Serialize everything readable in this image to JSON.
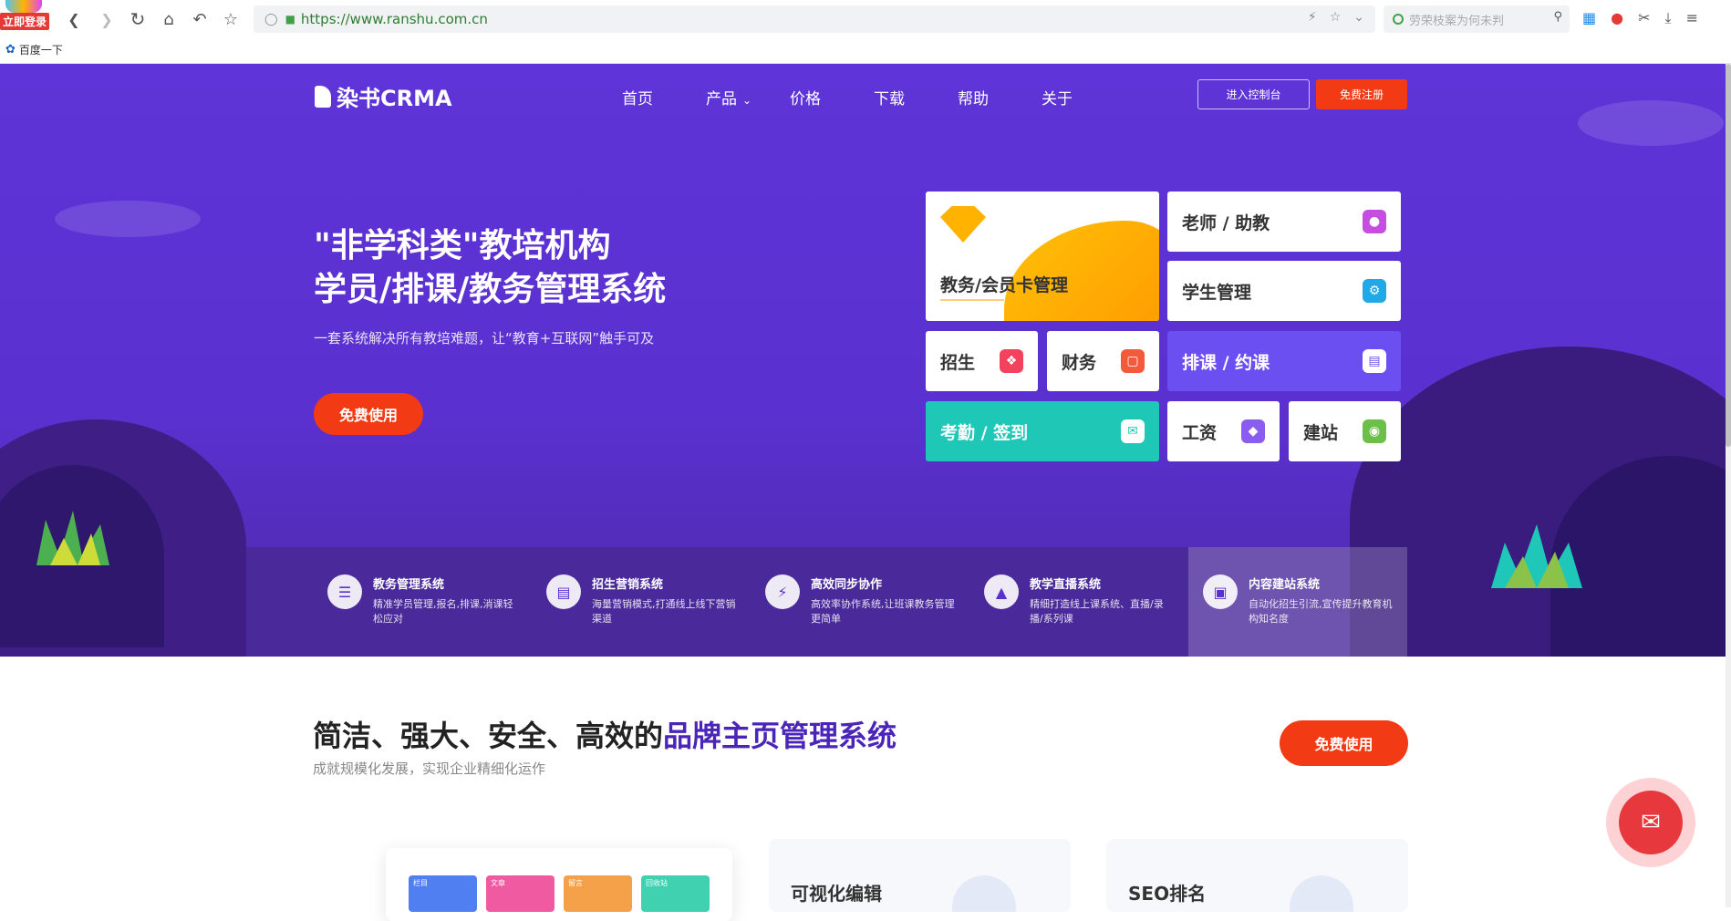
{
  "browser": {
    "login_badge": "立即登录",
    "url": "https://www.ranshu.com.cn",
    "search_placeholder": "劳荣枝案为何未判",
    "bookmark": "百度一下"
  },
  "header": {
    "logo": "染书CRMA",
    "nav": [
      "首页",
      "产品",
      "价格",
      "下载",
      "帮助",
      "关于"
    ],
    "console_button": "进入控制台",
    "register_button": "免费注册"
  },
  "hero": {
    "title_line1": "\"非学科类\"教培机构",
    "title_line2": "学员/排课/教务管理系统",
    "subtitle": "一套系统解决所有教培难题，让“教育+互联网”触手可及",
    "cta": "免费使用"
  },
  "tiles": {
    "membership": "教务/会员卡管理",
    "teacher": "老师 / 助教",
    "student": "学生管理",
    "enroll": "招生",
    "finance": "财务",
    "schedule": "排课 / 约课",
    "attendance": "考勤 / 签到",
    "salary": "工资",
    "website": "建站"
  },
  "features": [
    {
      "title": "教务管理系统",
      "desc": "精准学员管理,报名,排课,消课轻松应对"
    },
    {
      "title": "招生营销系统",
      "desc": "海量营销模式,打通线上线下营销渠道"
    },
    {
      "title": "高效同步协作",
      "desc": "高效率协作系统,让班课教务管理更简单"
    },
    {
      "title": "教学直播系统",
      "desc": "精细打造线上课系统、直播/录播/系列课"
    },
    {
      "title": "内容建站系统",
      "desc": "自动化招生引流,宣传提升教育机构知名度"
    }
  ],
  "section2": {
    "title_plain": "简洁、强大、安全、高效的",
    "title_highlight": "品牌主页管理系统",
    "subtitle": "成就规模化发展，实现企业精细化运作",
    "cta": "免费使用",
    "card1": "可视化编辑",
    "card2": "SEO排名",
    "dash_tiles": [
      "栏目",
      "文章",
      "留言",
      "回收站"
    ]
  },
  "colors": {
    "hero_bg": "#5f34d8",
    "accent_red": "#f23b14",
    "highlight_purple": "#4a25b8"
  }
}
